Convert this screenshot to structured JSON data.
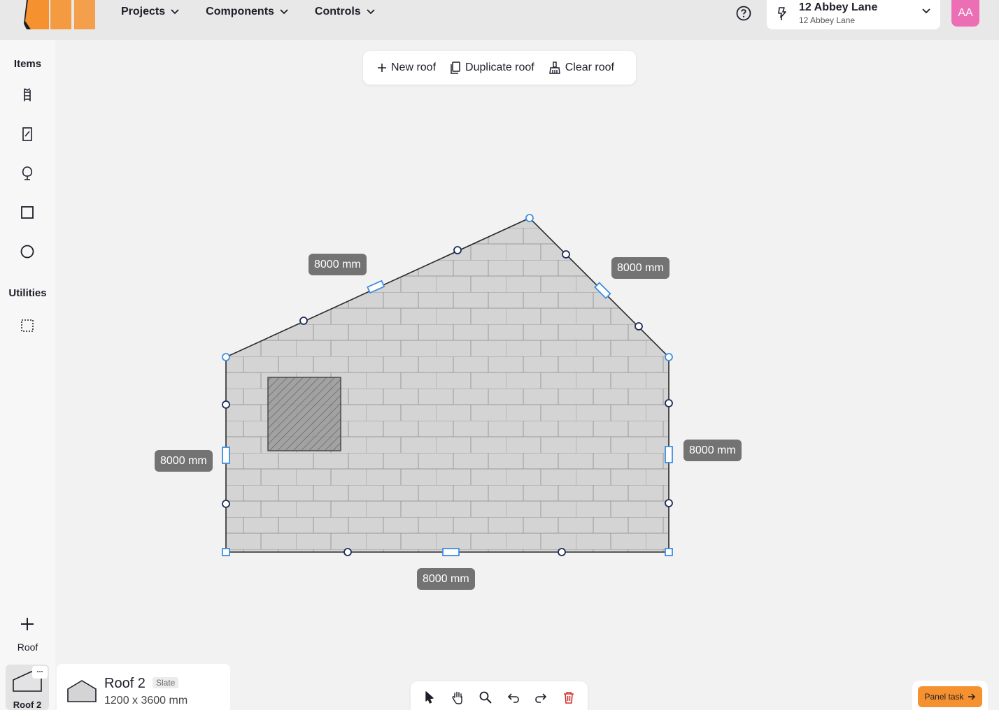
{
  "header": {
    "nav": [
      {
        "label": "Projects"
      },
      {
        "label": "Components"
      },
      {
        "label": "Controls"
      }
    ],
    "project": {
      "title": "12 Abbey Lane",
      "subtitle": "12 Abbey Lane"
    },
    "avatar": "AA"
  },
  "sidebar": {
    "items_heading": "Items",
    "items": [
      "ladder-icon",
      "panel-icon",
      "tree-icon",
      "square-icon",
      "circle-icon"
    ],
    "utilities_heading": "Utilities",
    "utilities": [
      "selection-icon"
    ],
    "add_label": "Roof",
    "roof_thumb_label": "Roof 2",
    "roof_thumb_more": "..."
  },
  "toolbar": {
    "new_roof": "New roof",
    "duplicate_roof": "Duplicate roof",
    "clear_roof": "Clear roof"
  },
  "canvas": {
    "dimensions": {
      "top_left": "8000 mm",
      "top_right": "8000 mm",
      "left": "8000 mm",
      "right": "8000 mm",
      "bottom": "8000 mm"
    }
  },
  "info_card": {
    "title": "Roof 2",
    "badge": "Slate",
    "dims": "1200 x 3600 mm"
  },
  "bottom_tools": [
    "pointer-icon",
    "hand-icon",
    "zoom-icon",
    "undo-icon",
    "redo-icon",
    "delete-icon"
  ],
  "panel_task": "Panel task",
  "colors": {
    "accent_orange": "#f5922f",
    "handle_blue": "#3d8fe0",
    "handle_navy": "#1c2b5a",
    "avatar_pink": "#ec6fb6",
    "delete_red": "#d0312d"
  }
}
